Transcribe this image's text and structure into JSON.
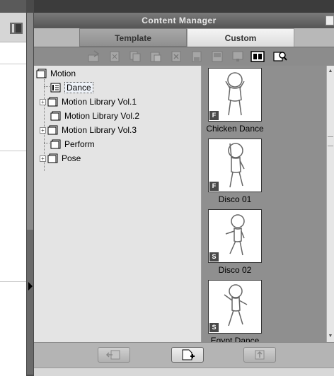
{
  "window": {
    "title": "Content Manager"
  },
  "tabs": [
    {
      "label": "Template",
      "active": false
    },
    {
      "label": "Custom",
      "active": true
    }
  ],
  "toolbar": {
    "icons": [
      "import-icon",
      "cut-icon",
      "copy-icon",
      "paste-icon",
      "delete-icon",
      "save-icon",
      "library-icon",
      "thumbnail-view-icon",
      "details-view-icon",
      "search-icon"
    ]
  },
  "tree": {
    "root": {
      "label": "Motion"
    },
    "items": [
      {
        "label": "Dance",
        "selected": true,
        "expandable": false
      },
      {
        "label": "Motion Library Vol.1",
        "expandable": true
      },
      {
        "label": "Motion Library Vol.2",
        "expandable": true
      },
      {
        "label": "Motion Library Vol.3",
        "expandable": true
      },
      {
        "label": "Perform",
        "expandable": false
      },
      {
        "label": "Pose",
        "expandable": true
      }
    ]
  },
  "library": {
    "items": [
      {
        "name": "Chicken Dance",
        "badge": "F"
      },
      {
        "name": "Disco 01",
        "badge": "F"
      },
      {
        "name": "Disco 02",
        "badge": "S"
      },
      {
        "name": "Egypt Dance",
        "badge": "S"
      }
    ]
  },
  "footer": {
    "buttons": [
      "back-button",
      "add-button",
      "export-button"
    ]
  }
}
